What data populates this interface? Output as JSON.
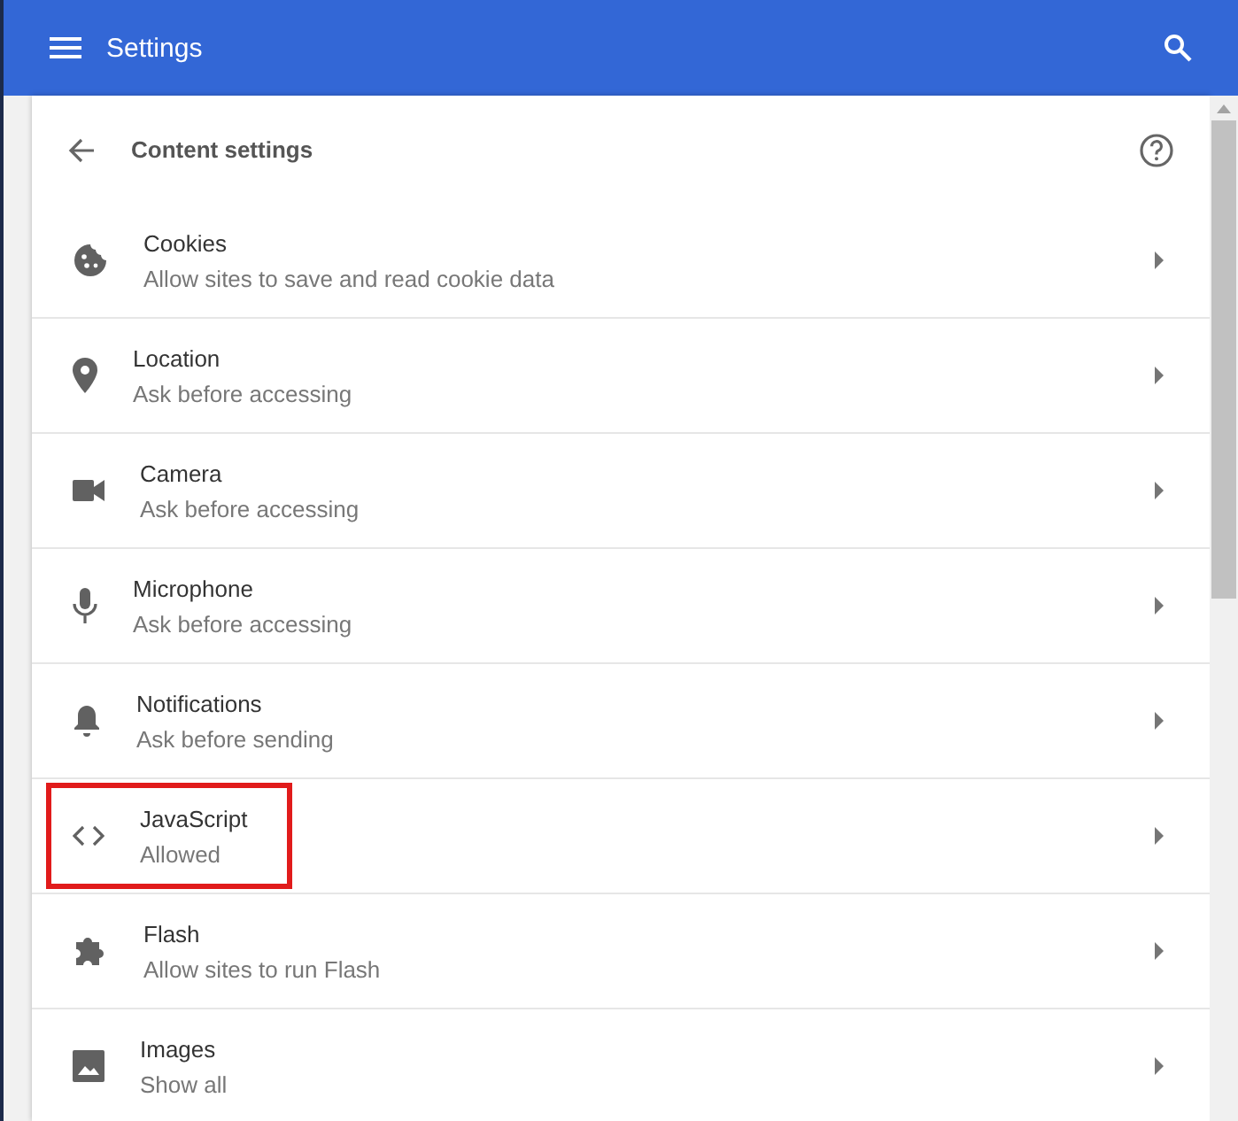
{
  "app_bar": {
    "title": "Settings"
  },
  "page": {
    "title": "Content settings"
  },
  "items": [
    {
      "kind": "cookie",
      "title": "Cookies",
      "subtitle": "Allow sites to save and read cookie data",
      "highlighted": false
    },
    {
      "kind": "location",
      "title": "Location",
      "subtitle": "Ask before accessing",
      "highlighted": false
    },
    {
      "kind": "camera",
      "title": "Camera",
      "subtitle": "Ask before accessing",
      "highlighted": false
    },
    {
      "kind": "microphone",
      "title": "Microphone",
      "subtitle": "Ask before accessing",
      "highlighted": false
    },
    {
      "kind": "notifications",
      "title": "Notifications",
      "subtitle": "Ask before sending",
      "highlighted": false
    },
    {
      "kind": "code",
      "title": "JavaScript",
      "subtitle": "Allowed",
      "highlighted": true
    },
    {
      "kind": "puzzle",
      "title": "Flash",
      "subtitle": "Allow sites to run Flash",
      "highlighted": false
    },
    {
      "kind": "image",
      "title": "Images",
      "subtitle": "Show all",
      "highlighted": false
    }
  ]
}
